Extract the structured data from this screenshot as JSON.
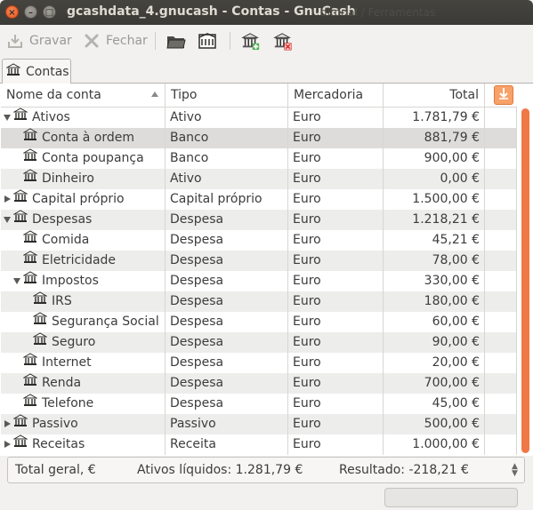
{
  "window": {
    "title": "gcashdata_4.gnucash - Contas - GnuCash",
    "background_text": "ditorial / Ferramentas"
  },
  "toolbar": {
    "save_label": "Gravar",
    "close_label": "Fechar"
  },
  "tab": {
    "label": "Contas"
  },
  "columns": {
    "name": "Nome da conta",
    "type": "Tipo",
    "commodity": "Mercadoria",
    "total": "Total"
  },
  "accounts": [
    {
      "name": "Ativos",
      "type": "Ativo",
      "commodity": "Euro",
      "total": "1.781,79 €",
      "level": 0,
      "expander": "open"
    },
    {
      "name": "Conta à ordem",
      "type": "Banco",
      "commodity": "Euro",
      "total": "881,79 €",
      "level": 1,
      "expander": "none",
      "selected": true
    },
    {
      "name": "Conta poupança",
      "type": "Banco",
      "commodity": "Euro",
      "total": "900,00 €",
      "level": 1,
      "expander": "none"
    },
    {
      "name": "Dinheiro",
      "type": "Ativo",
      "commodity": "Euro",
      "total": "0,00 €",
      "level": 1,
      "expander": "none"
    },
    {
      "name": "Capital próprio",
      "type": "Capital próprio",
      "commodity": "Euro",
      "total": "1.500,00 €",
      "level": 0,
      "expander": "closed"
    },
    {
      "name": "Despesas",
      "type": "Despesa",
      "commodity": "Euro",
      "total": "1.218,21 €",
      "level": 0,
      "expander": "open"
    },
    {
      "name": "Comida",
      "type": "Despesa",
      "commodity": "Euro",
      "total": "45,21 €",
      "level": 1,
      "expander": "none"
    },
    {
      "name": "Eletricidade",
      "type": "Despesa",
      "commodity": "Euro",
      "total": "78,00 €",
      "level": 1,
      "expander": "none"
    },
    {
      "name": "Impostos",
      "type": "Despesa",
      "commodity": "Euro",
      "total": "330,00 €",
      "level": 1,
      "expander": "open"
    },
    {
      "name": "IRS",
      "type": "Despesa",
      "commodity": "Euro",
      "total": "180,00 €",
      "level": 2,
      "expander": "none"
    },
    {
      "name": "Segurança Social",
      "type": "Despesa",
      "commodity": "Euro",
      "total": "60,00 €",
      "level": 2,
      "expander": "none"
    },
    {
      "name": "Seguro",
      "type": "Despesa",
      "commodity": "Euro",
      "total": "90,00 €",
      "level": 2,
      "expander": "none"
    },
    {
      "name": "Internet",
      "type": "Despesa",
      "commodity": "Euro",
      "total": "20,00 €",
      "level": 1,
      "expander": "none"
    },
    {
      "name": "Renda",
      "type": "Despesa",
      "commodity": "Euro",
      "total": "700,00 €",
      "level": 1,
      "expander": "none"
    },
    {
      "name": "Telefone",
      "type": "Despesa",
      "commodity": "Euro",
      "total": "45,00 €",
      "level": 1,
      "expander": "none"
    },
    {
      "name": "Passivo",
      "type": "Passivo",
      "commodity": "Euro",
      "total": "500,00 €",
      "level": 0,
      "expander": "closed"
    },
    {
      "name": "Receitas",
      "type": "Receita",
      "commodity": "Euro",
      "total": "1.000,00 €",
      "level": 0,
      "expander": "closed"
    }
  ],
  "summary": {
    "label": "Total geral, €",
    "net_assets": "Ativos líquidos: 1.281,79 €",
    "result": "Resultado: -218,21 €"
  },
  "colors": {
    "accent": "#f07746",
    "titlebar": "#3c3b37",
    "row_alt": "#ededeb"
  }
}
